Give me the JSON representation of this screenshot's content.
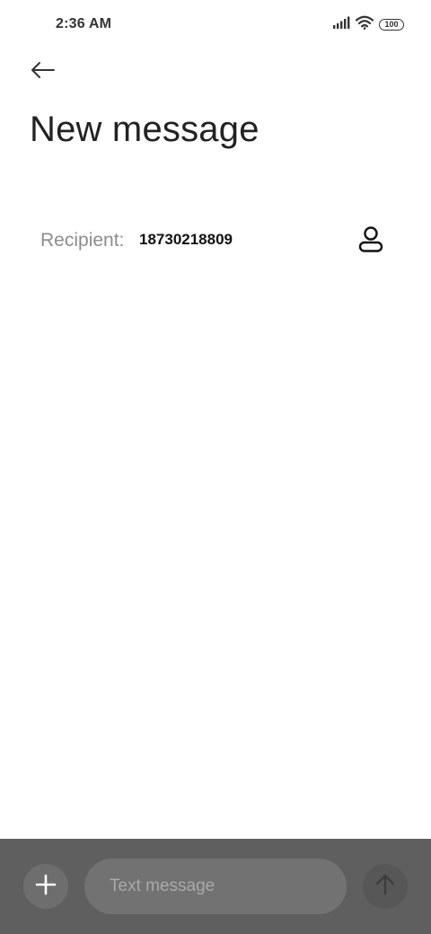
{
  "status_bar": {
    "time": "2:36 AM",
    "battery_level": "100",
    "icons": [
      "signal-icon",
      "wifi-icon",
      "battery-icon"
    ]
  },
  "header": {
    "back_icon": "back-arrow-icon",
    "title": "New message"
  },
  "recipient": {
    "label": "Recipient:",
    "value": "18730218809",
    "contact_icon": "person-icon"
  },
  "composer": {
    "add_icon": "plus-icon",
    "placeholder": "Text message",
    "value": "",
    "send_icon": "arrow-up-icon"
  },
  "colors": {
    "background": "#ffffff",
    "composer_background": "#5f5f5f",
    "input_background": "#727272",
    "label_gray": "#8c8c8c",
    "text_dark": "#111111"
  }
}
